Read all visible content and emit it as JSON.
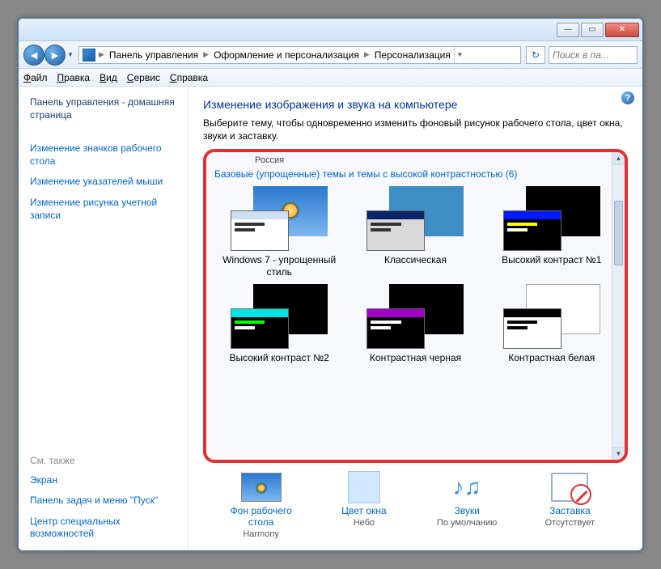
{
  "breadcrumbs": [
    "Панель управления",
    "Оформление и персонализация",
    "Персонализация"
  ],
  "search_placeholder": "Поиск в па...",
  "menubar": [
    "Файл",
    "Правка",
    "Вид",
    "Сервис",
    "Справка"
  ],
  "sidebar": {
    "home": "Панель управления - домашняя страница",
    "links": [
      "Изменение значков рабочего стола",
      "Изменение указателей мыши",
      "Изменение рисунка учетной записи"
    ],
    "see_also_label": "См. также",
    "see_also": [
      "Экран",
      "Панель задач и меню \"Пуск\"",
      "Центр специальных возможностей"
    ]
  },
  "content": {
    "title": "Изменение изображения и звука на компьютере",
    "description": "Выберите тему, чтобы одновременно изменить фоновый рисунок рабочего стола, цвет окна, звуки и заставку.",
    "hint": "Россия",
    "section_title": "Базовые (упрощенные) темы и темы с высокой контрастностью (6)",
    "themes": [
      {
        "name": "Windows 7 - упрощенный стиль",
        "bg": "#3a8dde",
        "bg2": "linear-gradient(to bottom,#2a78d0,#7eb7ee)",
        "fg_bg": "#ffffff",
        "tb": "#cfdff2",
        "line1": "#333",
        "line2": "#333",
        "show_orb": true
      },
      {
        "name": "Классическая",
        "bg": "#3c8ec4",
        "bg2": "#3c8ec4",
        "fg_bg": "#d9d9d9",
        "tb": "#0a246a",
        "line1": "#333",
        "line2": "#333",
        "show_orb": false
      },
      {
        "name": "Высокий контраст №1",
        "bg": "#000000",
        "bg2": "#000000",
        "fg_bg": "#000000",
        "tb": "#0019ff",
        "line1": "#ffff00",
        "line2": "#ffffff",
        "show_orb": false
      },
      {
        "name": "Высокий контраст №2",
        "bg": "#000000",
        "bg2": "#000000",
        "fg_bg": "#000000",
        "tb": "#00e6e6",
        "line1": "#00ff00",
        "line2": "#ffffff",
        "show_orb": false
      },
      {
        "name": "Контрастная черная",
        "bg": "#000000",
        "bg2": "#000000",
        "fg_bg": "#000000",
        "tb": "#a000c8",
        "line1": "#ffffff",
        "line2": "#ffffff",
        "show_orb": false
      },
      {
        "name": "Контрастная белая",
        "bg": "#ffffff",
        "bg2": "#ffffff",
        "fg_bg": "#ffffff",
        "tb": "#000000",
        "line1": "#000000",
        "line2": "#000000",
        "show_orb": false,
        "border": true
      }
    ]
  },
  "bottom_strip": [
    {
      "label": "Фон рабочего стола",
      "sub": "Harmony",
      "icon": "desktop"
    },
    {
      "label": "Цвет окна",
      "sub": "Небо",
      "icon": "color"
    },
    {
      "label": "Звуки",
      "sub": "По умолчанию",
      "icon": "sound"
    },
    {
      "label": "Заставка",
      "sub": "Отсутствует",
      "icon": "saver"
    }
  ]
}
